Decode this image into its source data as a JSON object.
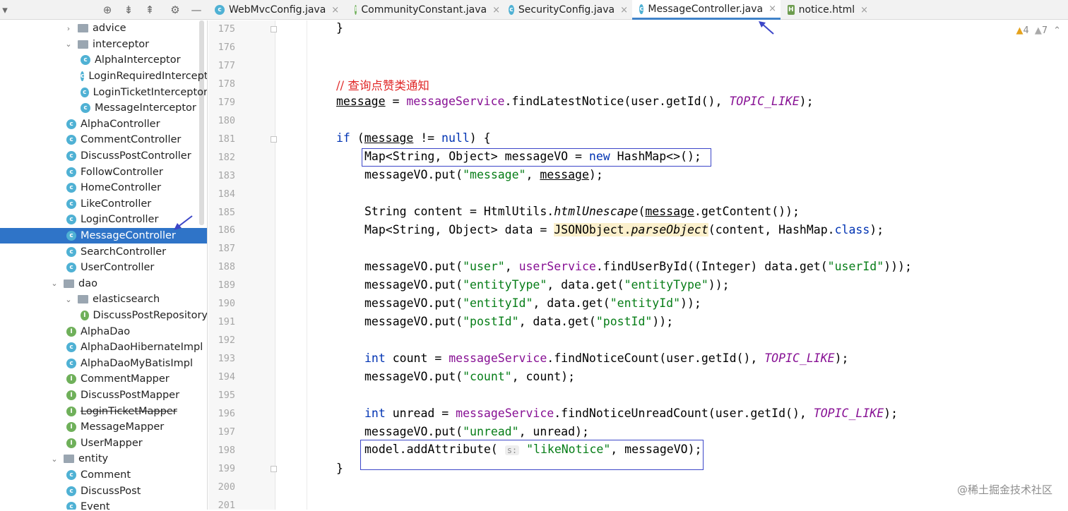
{
  "tabs": [
    {
      "label": "WebMvcConfig.java",
      "icon": "c",
      "active": false
    },
    {
      "label": "CommunityConstant.java",
      "icon": "i",
      "active": false
    },
    {
      "label": "SecurityConfig.java",
      "icon": "c",
      "active": false
    },
    {
      "label": "MessageController.java",
      "icon": "c",
      "active": true
    },
    {
      "label": "notice.html",
      "icon": "h",
      "active": false
    }
  ],
  "tree": [
    {
      "label": "advice",
      "type": "folder",
      "indent": 1,
      "arrow": "›"
    },
    {
      "label": "interceptor",
      "type": "folder",
      "indent": 1,
      "arrow": "⌄"
    },
    {
      "label": "AlphaInterceptor",
      "type": "class",
      "indent": 2
    },
    {
      "label": "LoginRequiredIntercept",
      "type": "class",
      "indent": 2
    },
    {
      "label": "LoginTicketInterceptor",
      "type": "class",
      "indent": 2
    },
    {
      "label": "MessageInterceptor",
      "type": "class",
      "indent": 2
    },
    {
      "label": "AlphaController",
      "type": "class",
      "indent": 1
    },
    {
      "label": "CommentController",
      "type": "class",
      "indent": 1
    },
    {
      "label": "DiscussPostController",
      "type": "class",
      "indent": 1
    },
    {
      "label": "FollowController",
      "type": "class",
      "indent": 1
    },
    {
      "label": "HomeController",
      "type": "class",
      "indent": 1
    },
    {
      "label": "LikeController",
      "type": "class",
      "indent": 1
    },
    {
      "label": "LoginController",
      "type": "class",
      "indent": 1
    },
    {
      "label": "MessageController",
      "type": "class",
      "indent": 1,
      "selected": true
    },
    {
      "label": "SearchController",
      "type": "class",
      "indent": 1
    },
    {
      "label": "UserController",
      "type": "class",
      "indent": 1
    },
    {
      "label": "dao",
      "type": "folder",
      "indent": 0,
      "arrow": "⌄"
    },
    {
      "label": "elasticsearch",
      "type": "folder",
      "indent": 1,
      "arrow": "⌄"
    },
    {
      "label": "DiscussPostRepository",
      "type": "interface",
      "indent": 2
    },
    {
      "label": "AlphaDao",
      "type": "interface",
      "indent": 1
    },
    {
      "label": "AlphaDaoHibernateImpl",
      "type": "class",
      "indent": 1
    },
    {
      "label": "AlphaDaoMyBatisImpl",
      "type": "class",
      "indent": 1
    },
    {
      "label": "CommentMapper",
      "type": "interface",
      "indent": 1
    },
    {
      "label": "DiscussPostMapper",
      "type": "interface",
      "indent": 1
    },
    {
      "label": "LoginTicketMapper",
      "type": "interface",
      "indent": 1,
      "strike": true
    },
    {
      "label": "MessageMapper",
      "type": "interface",
      "indent": 1
    },
    {
      "label": "UserMapper",
      "type": "interface",
      "indent": 1
    },
    {
      "label": "entity",
      "type": "folder",
      "indent": 0,
      "arrow": "⌄"
    },
    {
      "label": "Comment",
      "type": "class",
      "indent": 1
    },
    {
      "label": "DiscussPost",
      "type": "class",
      "indent": 1
    },
    {
      "label": "Event",
      "type": "class",
      "indent": 1
    }
  ],
  "line_numbers": [
    "175",
    "176",
    "177",
    "178",
    "179",
    "180",
    "181",
    "182",
    "183",
    "184",
    "185",
    "186",
    "187",
    "188",
    "189",
    "190",
    "191",
    "192",
    "193",
    "194",
    "195",
    "196",
    "197",
    "198",
    "199",
    "200",
    "201"
  ],
  "code": {
    "l175": "}",
    "l178": "// 查询点赞类通知",
    "l179a": "message",
    "l179b": " = ",
    "l179c": "messageService",
    "l179d": ".findLatestNotice(user.getId(), ",
    "l179e": "TOPIC_LIKE",
    "l179f": ");",
    "l181a": "if",
    "l181b": " (",
    "l181c": "message",
    "l181d": " != ",
    "l181e": "null",
    "l181f": ") {",
    "l182a": "Map<String, Object> messageVO = ",
    "l182b": "new",
    "l182c": " HashMap<>();",
    "l183a": "messageVO.put(",
    "l183b": "\"message\"",
    "l183c": ", ",
    "l183d": "message",
    "l183e": ");",
    "l185a": "String content = HtmlUtils.",
    "l185b": "htmlUnescape",
    "l185c": "(",
    "l185d": "message",
    "l185e": ".getContent());",
    "l186a": "Map<String, Object> data = ",
    "l186b": "JSONObject.",
    "l186c": "parseObject",
    "l186d": "(content, HashMap.",
    "l186e": "class",
    "l186f": ");",
    "l188a": "messageVO.put(",
    "l188b": "\"user\"",
    "l188c": ", ",
    "l188d": "userService",
    "l188e": ".findUserById((Integer) data.get(",
    "l188f": "\"userId\"",
    "l188g": ")));",
    "l189a": "messageVO.put(",
    "l189b": "\"entityType\"",
    "l189c": ", data.get(",
    "l189d": "\"entityType\"",
    "l189e": "));",
    "l190a": "messageVO.put(",
    "l190b": "\"entityId\"",
    "l190c": ", data.get(",
    "l190d": "\"entityId\"",
    "l190e": "));",
    "l191a": "messageVO.put(",
    "l191b": "\"postId\"",
    "l191c": ", data.get(",
    "l191d": "\"postId\"",
    "l191e": "));",
    "l193a": "int",
    "l193b": " count = ",
    "l193c": "messageService",
    "l193d": ".findNoticeCount(user.getId(), ",
    "l193e": "TOPIC_LIKE",
    "l193f": ");",
    "l194a": "messageVO.put(",
    "l194b": "\"count\"",
    "l194c": ", count);",
    "l196a": "int",
    "l196b": " unread = ",
    "l196c": "messageService",
    "l196d": ".findNoticeUnreadCount(user.getId(), ",
    "l196e": "TOPIC_LIKE",
    "l196f": ");",
    "l197a": "messageVO.put(",
    "l197b": "\"unread\"",
    "l197c": ", unread);",
    "l198a": "model.addAttribute(",
    "l198hint": "s:",
    "l198b": "\"likeNotice\"",
    "l198c": ", messageVO);",
    "l199": "}"
  },
  "warnings": {
    "warn_count": "4",
    "weak_count": "7"
  },
  "watermark": "@稀土掘金技术社区"
}
